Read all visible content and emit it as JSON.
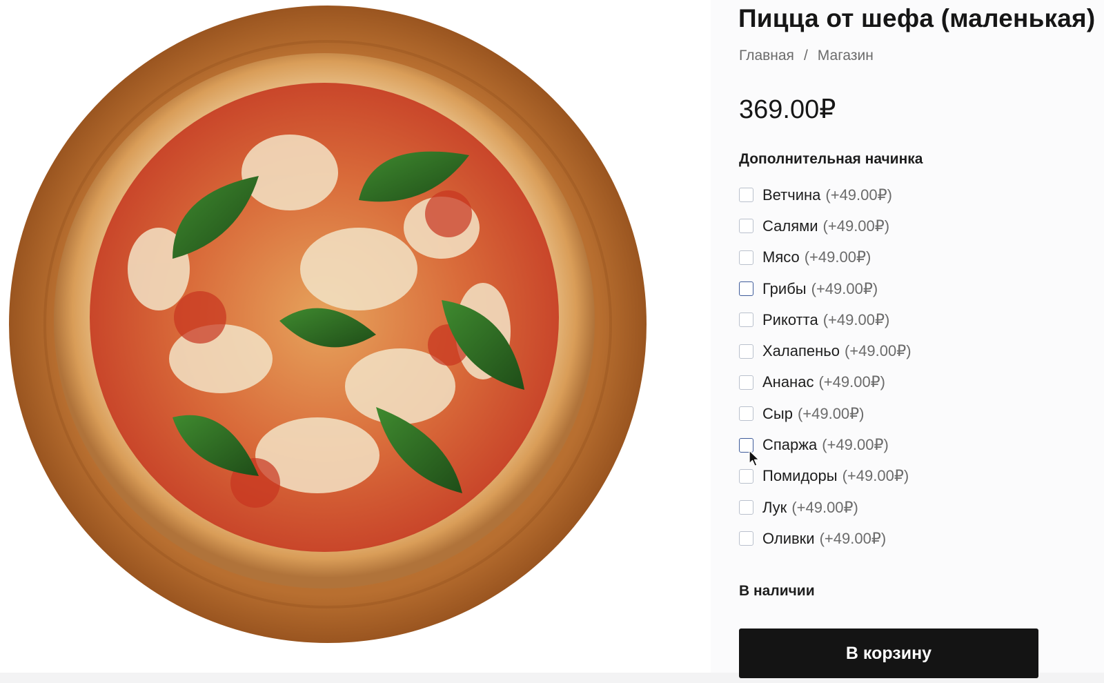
{
  "product": {
    "title": "Пицца от шефа (маленькая)",
    "price": "369.00₽",
    "image_alt": "pizza-image"
  },
  "breadcrumb": {
    "home": "Главная",
    "separator": "/",
    "shop": "Магазин"
  },
  "addons": {
    "label": "Дополнительная начинка",
    "items": [
      {
        "name": "Ветчина",
        "price": "(+49.00₽)"
      },
      {
        "name": "Салями",
        "price": "(+49.00₽)"
      },
      {
        "name": "Мясо",
        "price": "(+49.00₽)"
      },
      {
        "name": "Грибы",
        "price": "(+49.00₽)"
      },
      {
        "name": "Рикотта",
        "price": "(+49.00₽)"
      },
      {
        "name": "Халапеньо",
        "price": "(+49.00₽)"
      },
      {
        "name": "Ананас",
        "price": "(+49.00₽)"
      },
      {
        "name": "Сыр",
        "price": "(+49.00₽)"
      },
      {
        "name": "Спаржа",
        "price": "(+49.00₽)"
      },
      {
        "name": "Помидоры",
        "price": "(+49.00₽)"
      },
      {
        "name": "Лук",
        "price": "(+49.00₽)"
      },
      {
        "name": "Оливки",
        "price": "(+49.00₽)"
      }
    ]
  },
  "stock": {
    "label": "В наличии"
  },
  "cart_button": {
    "label": "В корзину"
  },
  "colors": {
    "button_bg": "#141414",
    "button_text": "#ffffff",
    "checkbox_border": "#b9c0cc",
    "checkbox_focus": "#3d5a99",
    "muted_text": "#6b6b6b",
    "panel_bg": "#fbfbfc"
  },
  "icons": {
    "cursor": "mouse-pointer-icon"
  }
}
